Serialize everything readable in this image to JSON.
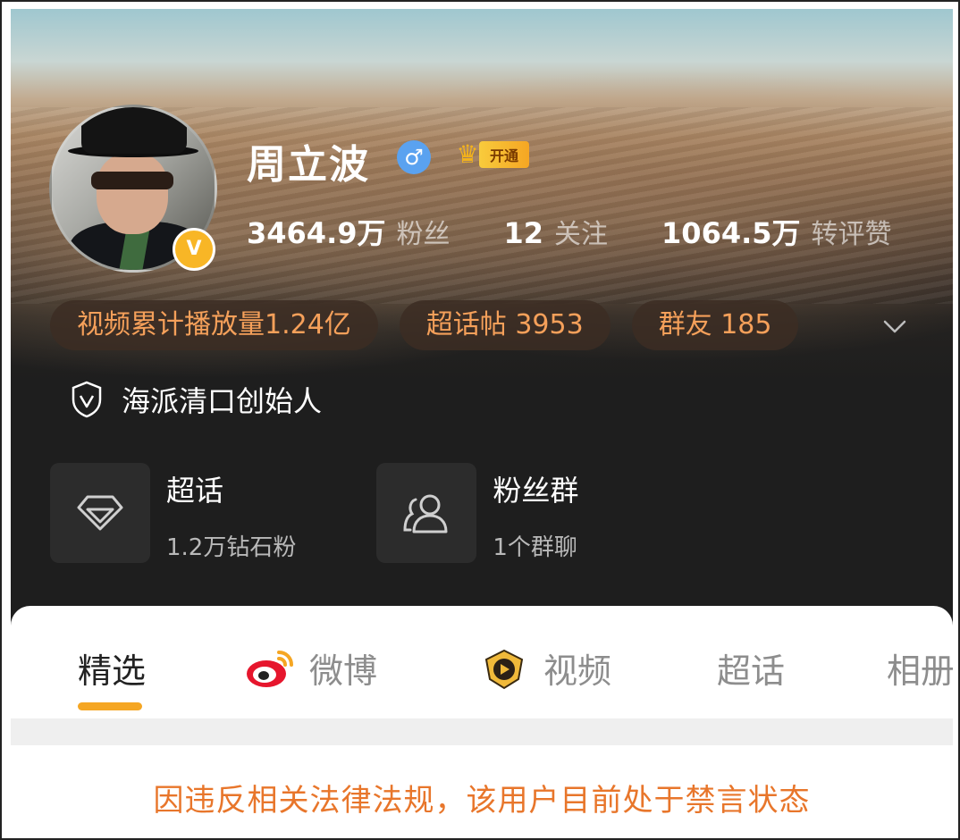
{
  "profile": {
    "name": "周立波",
    "verified_badge": "V",
    "vip_label": "开通",
    "icons": {
      "gender": "male-icon",
      "vip": "crown-icon"
    }
  },
  "stats": [
    {
      "value": "3464.9万",
      "label": "粉丝"
    },
    {
      "value": "12",
      "label": "关注"
    },
    {
      "value": "1064.5万",
      "label": "转评赞"
    }
  ],
  "pills": [
    "视频累计播放量1.24亿",
    "超话帖 3953",
    "群友 185"
  ],
  "certification": "海派清口创始人",
  "cards": [
    {
      "title": "超话",
      "sub": "1.2万钻石粉",
      "icon": "diamond-icon"
    },
    {
      "title": "粉丝群",
      "sub": "1个群聊",
      "icon": "group-icon"
    }
  ],
  "tabs": [
    {
      "label": "精选",
      "active": true
    },
    {
      "label": "微博",
      "icon": "weibo-icon"
    },
    {
      "label": "视频",
      "icon": "video-icon"
    },
    {
      "label": "超话"
    },
    {
      "label": "相册"
    }
  ],
  "notice": "因违反相关法律法规，该用户目前处于禁言状态",
  "colors": {
    "accent": "#f5a623",
    "notice": "#e8762b",
    "pill_text": "#f5a05a",
    "gender": "#5aa2f0"
  }
}
